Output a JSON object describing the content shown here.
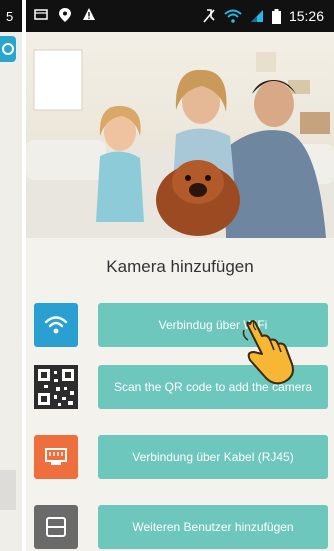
{
  "left_panel": {
    "clock_digit": "5"
  },
  "status_bar": {
    "time": "15:26",
    "icons": [
      "screenshot-icon",
      "location-icon",
      "warning-icon",
      "mute-icon",
      "wifi-signal-icon",
      "cell-signal-icon",
      "battery-icon"
    ]
  },
  "main": {
    "title": "Kamera hinzufügen",
    "options": [
      {
        "icon": "wifi-icon",
        "label": "Verbindug über WiFi"
      },
      {
        "icon": "qr-code-icon",
        "label": "Scan the QR code to add the camera"
      },
      {
        "icon": "ethernet-icon",
        "label": "Verbindung über Kabel (RJ45)"
      },
      {
        "icon": "user-add-icon",
        "label": "Weiteren Benutzer hinzufügen"
      }
    ]
  },
  "colors": {
    "button": "#6ec7bd",
    "wifi": "#2a9fd1",
    "ethernet": "#ef6e3e",
    "user": "#6a6a6a"
  }
}
